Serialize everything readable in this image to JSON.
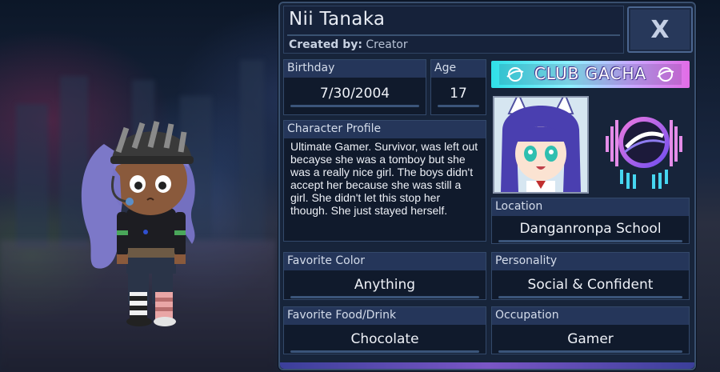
{
  "character": {
    "name": "Nii Tanaka",
    "created_by_label": "Created by:",
    "created_by_value": "Creator"
  },
  "close_label": "X",
  "birthday": {
    "label": "Birthday",
    "value": "7/30/2004"
  },
  "age": {
    "label": "Age",
    "value": "17"
  },
  "profile": {
    "label": "Character Profile",
    "text": "Ultimate Gamer. Survivor, was left out becayse she was a tomboy but she was a really nice girl. The boys didn't accept her because she was still a girl. She didn't let this stop her though. She just stayed herself."
  },
  "club_banner": "CLUB GACHA",
  "location": {
    "label": "Location",
    "value": "Danganronpa School"
  },
  "favorite_color": {
    "label": "Favorite Color",
    "value": "Anything"
  },
  "personality": {
    "label": "Personality",
    "value": "Social & Confident"
  },
  "favorite_food": {
    "label": "Favorite Food/Drink",
    "value": "Chocolate"
  },
  "occupation": {
    "label": "Occupation",
    "value": "Gamer"
  },
  "colors": {
    "panel": "#17243a",
    "label_bar": "#25365a",
    "border": "#33496a",
    "banner_start": "#2fe0e8",
    "banner_end": "#e26ce6"
  },
  "icons": [
    "close-icon",
    "gacha-planet-logo"
  ]
}
